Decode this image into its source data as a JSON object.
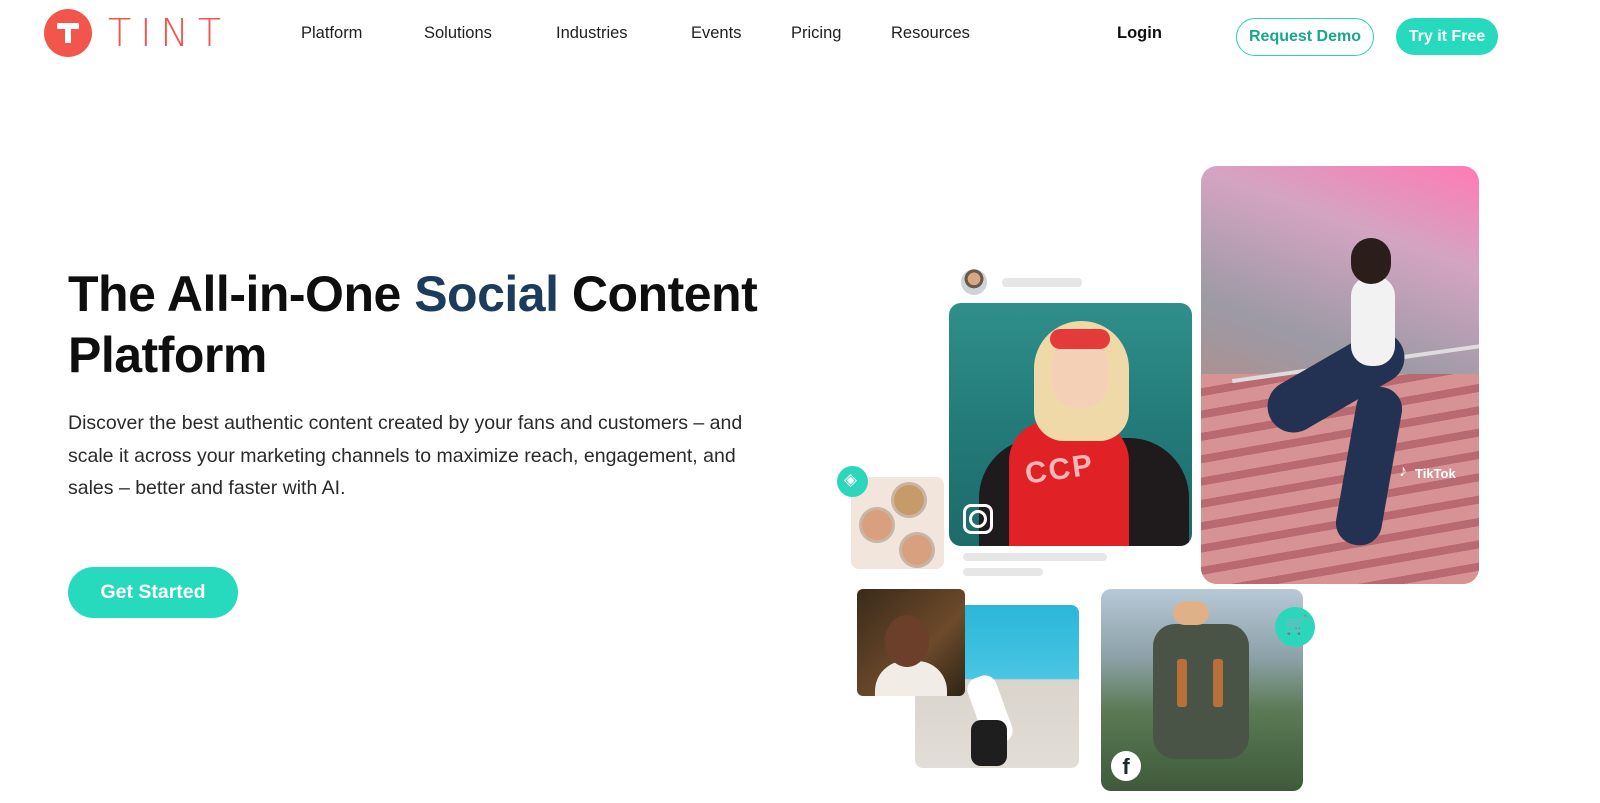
{
  "header": {
    "logo_text": "TINT",
    "nav": [
      {
        "label": "Platform",
        "name": "nav-platform"
      },
      {
        "label": "Solutions",
        "name": "nav-solutions"
      },
      {
        "label": "Industries",
        "name": "nav-industries"
      },
      {
        "label": "Events",
        "name": "nav-events"
      },
      {
        "label": "Pricing",
        "name": "nav-pricing"
      },
      {
        "label": "Resources",
        "name": "nav-resources"
      }
    ],
    "login_label": "Login",
    "demo_label": "Request Demo",
    "free_label": "Try it Free"
  },
  "hero": {
    "title_part1": "The All-in-One ",
    "title_accent": "Social",
    "title_part2": " Content Platform",
    "description": "Discover the best authentic content created by your fans and customers – and scale it across your marketing channels to maximize reach, engagement, and sales – better and faster with AI.",
    "cta_label": "Get Started"
  },
  "collage": {
    "tiktok_label": "TikTok",
    "insta_shirt_text": "CCP",
    "icons": [
      "instagram-icon",
      "facebook-icon",
      "tiktok-icon",
      "price-tag-icon",
      "shopping-cart-icon"
    ]
  },
  "colors": {
    "brand": "#f2554c",
    "accent": "#27d9bd",
    "heading_accent": "#1d3b5a"
  }
}
